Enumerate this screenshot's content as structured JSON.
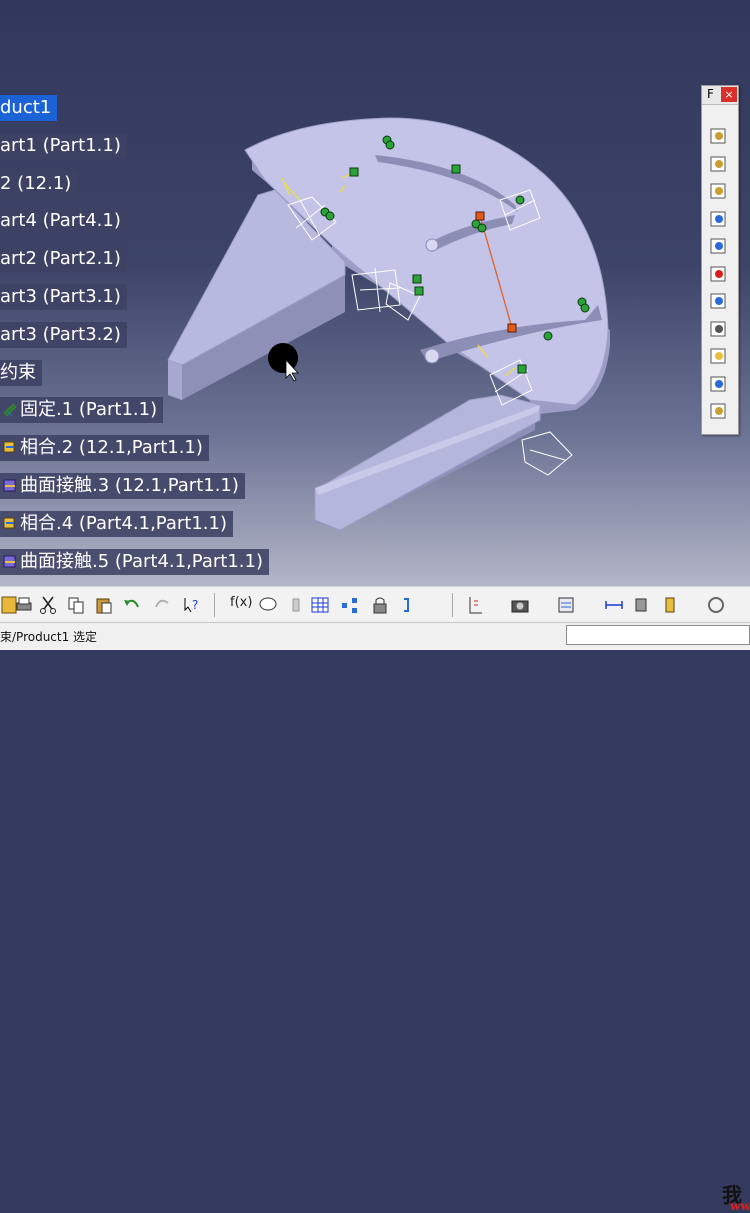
{
  "tree": {
    "root": "duct1",
    "items": [
      {
        "label": "art1 (Part1.1)",
        "icon": "part-icon"
      },
      {
        "label": "2 (12.1)",
        "icon": "part-icon"
      },
      {
        "label": "art4 (Part4.1)",
        "icon": "part-icon"
      },
      {
        "label": "art2 (Part2.1)",
        "icon": "part-icon"
      },
      {
        "label": "art3 (Part3.1)",
        "icon": "part-icon"
      },
      {
        "label": "art3 (Part3.2)",
        "icon": "part-icon"
      },
      {
        "label": "约束",
        "icon": "constraints-icon"
      }
    ],
    "constraints": [
      {
        "label": "固定.1 (Part1.1)",
        "icon": "fix-constraint-icon"
      },
      {
        "label": "相合.2 (12.1,Part1.1)",
        "icon": "coincidence-constraint-icon"
      },
      {
        "label": "曲面接触.3 (12.1,Part1.1)",
        "icon": "surface-contact-constraint-icon"
      },
      {
        "label": "相合.4 (Part4.1,Part1.1)",
        "icon": "coincidence-constraint-icon"
      },
      {
        "label": "曲面接触.5 (Part4.1,Part1.1)",
        "icon": "surface-contact-constraint-icon"
      }
    ]
  },
  "right_toolbar": {
    "title_glyph": "F",
    "close_label": "×",
    "buttons": [
      "gear-update-icon",
      "gear-update-all-icon",
      "gear-manage-icon",
      "insert-component-icon",
      "insert-product-icon",
      "replace-component-icon",
      "reorder-icon",
      "numbering-icon",
      "multi-instantiate-icon",
      "fast-multi-instantiate-icon",
      "defeature-icon"
    ]
  },
  "bottom_toolbar": {
    "fx_label": "f(x)",
    "watermark_top": "我",
    "watermark_bottom": "ww"
  },
  "status": {
    "text": "束/Product1 选定",
    "input_value": ""
  },
  "colors": {
    "accent_selected": "#1a62d6",
    "tree_bg": "#3e4264",
    "part_face": "#b9badf",
    "part_side": "#9c9dc4"
  }
}
